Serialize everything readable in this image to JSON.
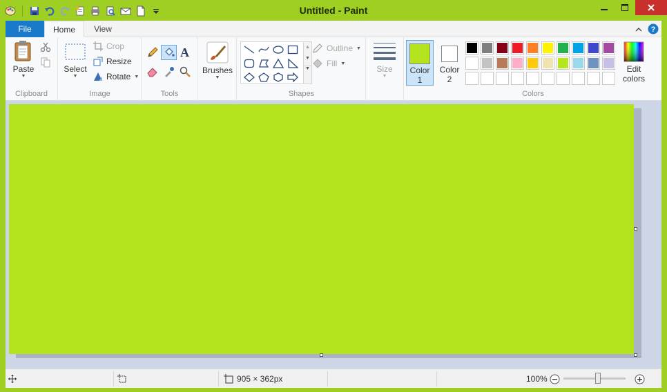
{
  "window": {
    "title": "Untitled - Paint"
  },
  "colors": {
    "frame": "#9fcf22",
    "canvas": "#b3e31d",
    "file_tab": "#1979ca",
    "close": "#c7302b"
  },
  "quick_access": [
    "paint-app-icon",
    "save-icon",
    "undo-icon",
    "redo-icon",
    "properties-icon",
    "print-icon",
    "print-preview-icon",
    "email-icon",
    "new-icon",
    "customize-qat-icon"
  ],
  "tabs": {
    "file": "File",
    "home": "Home",
    "view": "View"
  },
  "ribbon": {
    "clipboard": {
      "paste": "Paste",
      "label": "Clipboard"
    },
    "image": {
      "select": "Select",
      "crop": "Crop",
      "resize": "Resize",
      "rotate": "Rotate",
      "label": "Image"
    },
    "tools": {
      "label": "Tools",
      "text_tool": "A"
    },
    "brushes": {
      "label": "Brushes"
    },
    "shapes": {
      "outline": "Outline",
      "fill": "Fill",
      "label": "Shapes"
    },
    "size": {
      "label": "Size"
    },
    "colors": {
      "color1": "Color",
      "color1_num": "1",
      "color2": "Color",
      "color2_num": "2",
      "edit": "Edit",
      "edit2": "colors",
      "label": "Colors",
      "color1_value": "#b3e31d",
      "color2_value": "#ffffff",
      "palette_row1": [
        "#000000",
        "#7f7f7f",
        "#880015",
        "#ed1c24",
        "#ff7f27",
        "#fff200",
        "#22b14c",
        "#00a2e8",
        "#3f48cc",
        "#a349a4"
      ],
      "palette_row2": [
        "#ffffff",
        "#c3c3c3",
        "#b97a57",
        "#ffaec9",
        "#ffc90e",
        "#efe4b0",
        "#b5e61d",
        "#99d9ea",
        "#7092be",
        "#c8bfe7"
      ],
      "palette_row3": [
        "#ffffff",
        "#ffffff",
        "#ffffff",
        "#ffffff",
        "#ffffff",
        "#ffffff",
        "#ffffff",
        "#ffffff",
        "#ffffff",
        "#ffffff"
      ]
    }
  },
  "status": {
    "size": "905 × 362px",
    "zoom": "100%"
  }
}
